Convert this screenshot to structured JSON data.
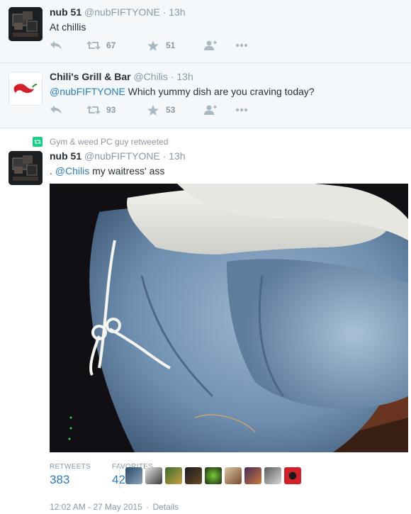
{
  "tweets": [
    {
      "name": "nub 51",
      "handle": "@nubFIFTYONE",
      "dot": "·",
      "time": "13h",
      "text": "At chillis",
      "retweets": "67",
      "favorites": "51"
    },
    {
      "name": "Chili's Grill & Bar",
      "handle": "@Chilis",
      "dot": "·",
      "time": "13h",
      "mention": "@nubFIFTYONE",
      "text": " Which yummy dish are you craving today?",
      "retweets": "93",
      "favorites": "53"
    }
  ],
  "retweet_context": "Gym & weed PC guy retweeted",
  "main_tweet": {
    "name": "nub 51",
    "handle": "@nubFIFTYONE",
    "dot": "·",
    "time": "13h",
    "text_prefix": ". ",
    "mention": "@Chilis",
    "text": " my waitress' ass",
    "stats": {
      "retweets_label": "RETWEETS",
      "retweets_value": "383",
      "favorites_label": "FAVORITES",
      "favorites_value": "420"
    },
    "footer": {
      "timestamp": "12:02 AM - 27 May 2015",
      "sep": "·",
      "details": "Details"
    }
  },
  "colors": {
    "link": "#2b7bb9",
    "muted": "#8899a6",
    "retweet_green": "#19cf86",
    "background_alt": "#f5f8fa"
  },
  "icons": [
    "reply-icon",
    "retweet-icon",
    "favorite-star-icon",
    "follow-icon",
    "more-icon"
  ]
}
